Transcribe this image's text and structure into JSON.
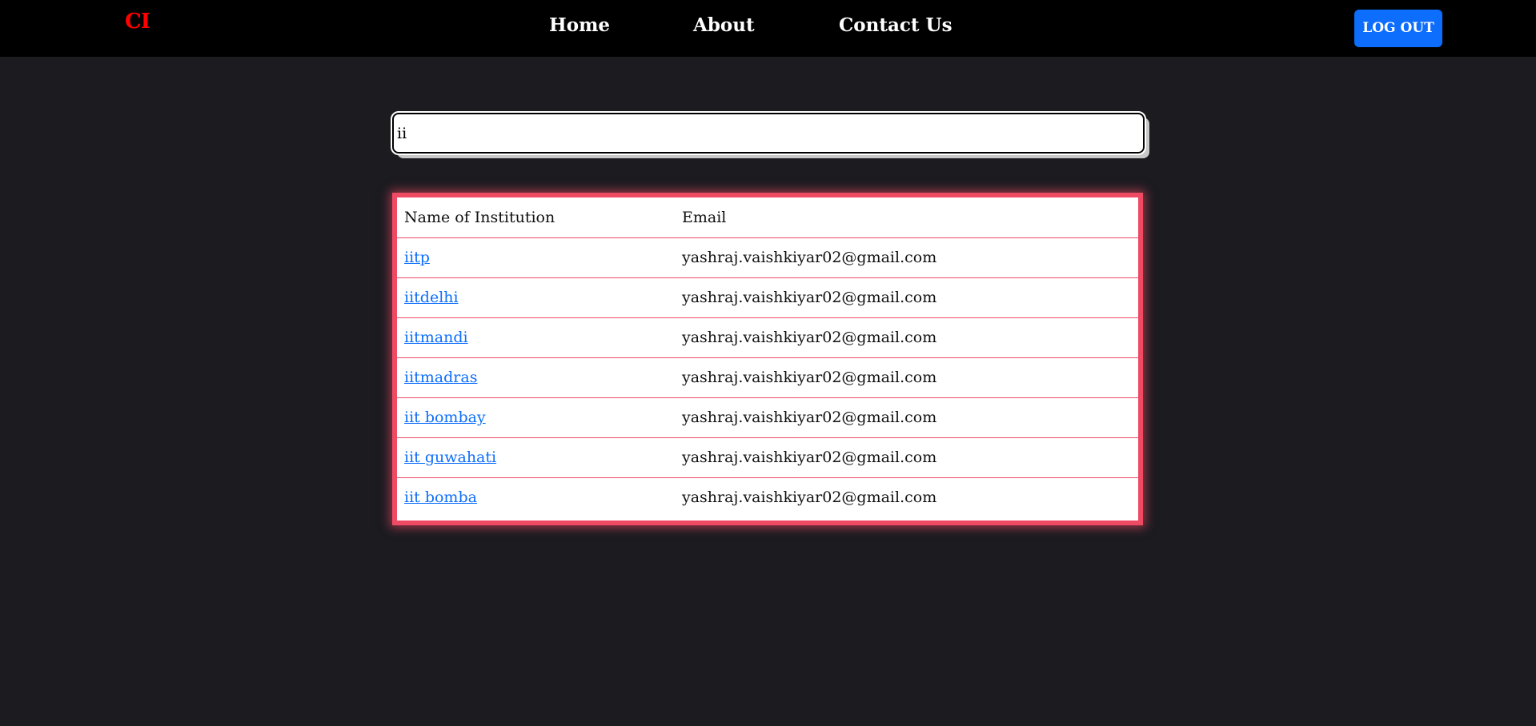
{
  "navbar": {
    "logo": "CI",
    "links": [
      "Home",
      "About",
      "Contact Us"
    ],
    "logout_label": "LOG OUT"
  },
  "search": {
    "value": "ii"
  },
  "table": {
    "headers": [
      "Name of Institution",
      "Email"
    ],
    "rows": [
      {
        "name": "iitp",
        "email": "yashraj.vaishkiyar02@gmail.com"
      },
      {
        "name": "iitdelhi",
        "email": "yashraj.vaishkiyar02@gmail.com"
      },
      {
        "name": "iitmandi",
        "email": "yashraj.vaishkiyar02@gmail.com"
      },
      {
        "name": "iitmadras",
        "email": "yashraj.vaishkiyar02@gmail.com"
      },
      {
        "name": "iit bombay",
        "email": "yashraj.vaishkiyar02@gmail.com"
      },
      {
        "name": "iit guwahati",
        "email": "yashraj.vaishkiyar02@gmail.com"
      },
      {
        "name": "iit bomba",
        "email": "yashraj.vaishkiyar02@gmail.com"
      }
    ]
  },
  "colors": {
    "accent": "#ef4a63",
    "logo": "#ff0000",
    "button": "#0d6efd",
    "background": "#1b1b20"
  }
}
